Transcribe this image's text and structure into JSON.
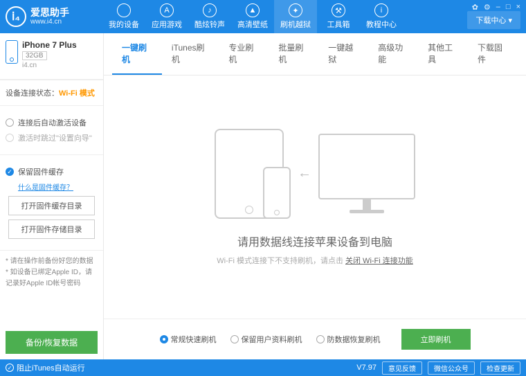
{
  "header": {
    "app_name": "爱思助手",
    "url": "www.i4.cn",
    "download": "下载中心 ▾",
    "nav": [
      {
        "label": "我的设备",
        "icon": ""
      },
      {
        "label": "应用游戏",
        "icon": "A"
      },
      {
        "label": "酷炫铃声",
        "icon": "♪"
      },
      {
        "label": "高清壁纸",
        "icon": "▲"
      },
      {
        "label": "刷机越狱",
        "icon": "✦"
      },
      {
        "label": "工具箱",
        "icon": "⚒"
      },
      {
        "label": "教程中心",
        "icon": "i"
      }
    ],
    "win": {
      "settings": "✿",
      "gear": "⚙",
      "min": "–",
      "max": "□",
      "close": "×"
    }
  },
  "sidebar": {
    "device": {
      "name": "iPhone 7 Plus",
      "capacity": "32GB",
      "source": "i4.cn"
    },
    "conn": {
      "label": "设备连接状态：",
      "mode": "Wi-Fi 模式"
    },
    "opts": {
      "opt1": "连接后自动激活设备",
      "opt2": "激活时跳过\"设置向导\""
    },
    "cache": {
      "label": "保留固件缓存",
      "link": "什么是固件缓存？",
      "btn1": "打开固件缓存目录",
      "btn2": "打开固件存储目录"
    },
    "notes": {
      "n1": "* 请在操作前备份好您的数据",
      "n2": "* 如设备已绑定Apple ID，请记录好Apple ID帐号密码"
    },
    "backup": "备份/恢复数据"
  },
  "tabs": [
    "一键刷机",
    "iTunes刷机",
    "专业刷机",
    "批量刷机",
    "一键越狱",
    "高级功能",
    "其他工具",
    "下载固件"
  ],
  "content": {
    "title": "请用数据线连接苹果设备到电脑",
    "sub_pre": "Wi-Fi 模式连接下不支持刷机，请点击 ",
    "sub_link": "关闭 Wi-Fi 连接功能"
  },
  "footer_opts": {
    "o1": "常规快速刷机",
    "o2": "保留用户资料刷机",
    "o3": "防数据恢复刷机",
    "flash": "立即刷机"
  },
  "statusbar": {
    "stop": "阻止iTunes自动运行",
    "version": "V7.97",
    "b1": "意见反馈",
    "b2": "微信公众号",
    "b3": "检查更新"
  }
}
